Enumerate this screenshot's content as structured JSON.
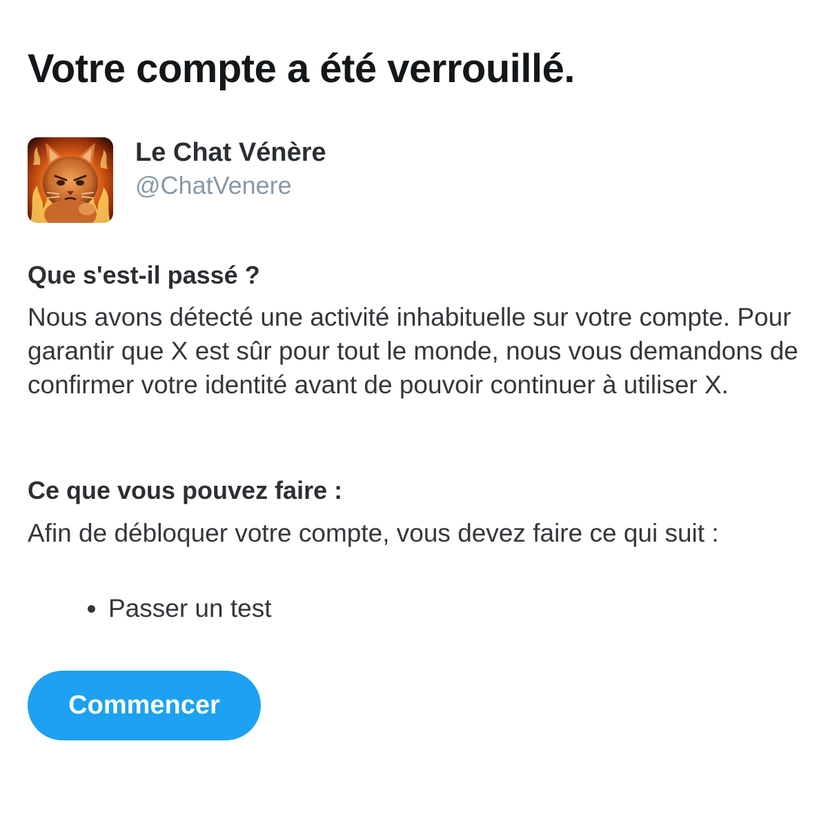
{
  "header": {
    "title": "Votre compte a été verrouillé."
  },
  "profile": {
    "display_name": "Le Chat Vénère",
    "handle": "@ChatVenere",
    "avatar_icon": "angry-cat-flames-avatar"
  },
  "what_happened": {
    "heading": "Que s'est-il passé ?",
    "body": "Nous avons détecté une activité inhabituelle sur votre compte. Pour garantir que X est sûr pour tout le monde, nous vous demandons de confirmer votre identité avant de pouvoir continuer à utiliser X."
  },
  "what_you_can_do": {
    "heading": "Ce que vous pouvez faire :",
    "body": "Afin de débloquer votre compte, vous devez faire ce qui suit :",
    "steps": [
      {
        "label": "Passer un test"
      }
    ]
  },
  "actions": {
    "start_label": "Commencer"
  },
  "colors": {
    "accent": "#1da1f2",
    "handle": "#8899a6",
    "text": "#33373b"
  }
}
